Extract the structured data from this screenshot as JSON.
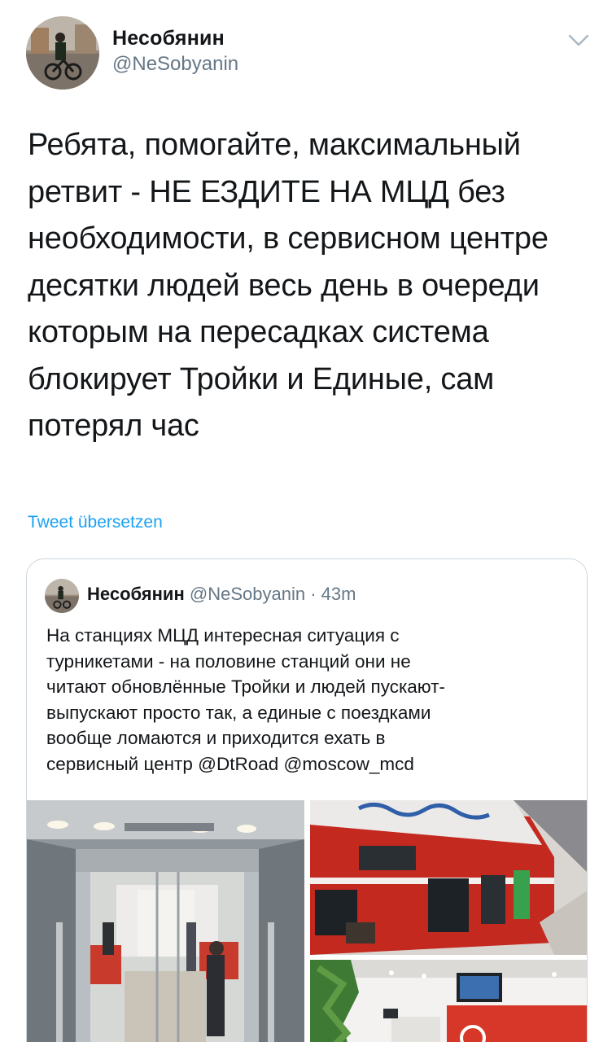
{
  "author": {
    "display_name": "Несобянин",
    "handle": "@NeSobyanin"
  },
  "tweet": {
    "text": "Ребята, помогайте, максимальный\nретвит - НЕ ЕЗДИТЕ НА МЦД без\nнеобходимости, в сервисном центре\nдесятки людей весь день в очереди\nкоторым на пересадках система\nблокирует Тройки и Единые, сам\nпотерял час",
    "translate_label": "Tweet übersetzen"
  },
  "quoted": {
    "display_name": "Несобянин",
    "handle": "@NeSobyanin",
    "separator": "·",
    "time": "43m",
    "text": "На станциях МЦД интересная ситуация с\nтурникетами - на половине станций они не\nчитают обновлённые Тройки и людей пускают-\nвыпускают просто так, а единые с поездками\nвообще ломаются и приходится ехать в\nсервисный центр @DtRoad @moscow_mcd"
  },
  "icons": {
    "chevron": "chevron-down-icon"
  },
  "colors": {
    "link": "#1da1f2",
    "secondary_text": "#657786",
    "train_red": "#c4291f",
    "border": "#ccd6dd"
  }
}
